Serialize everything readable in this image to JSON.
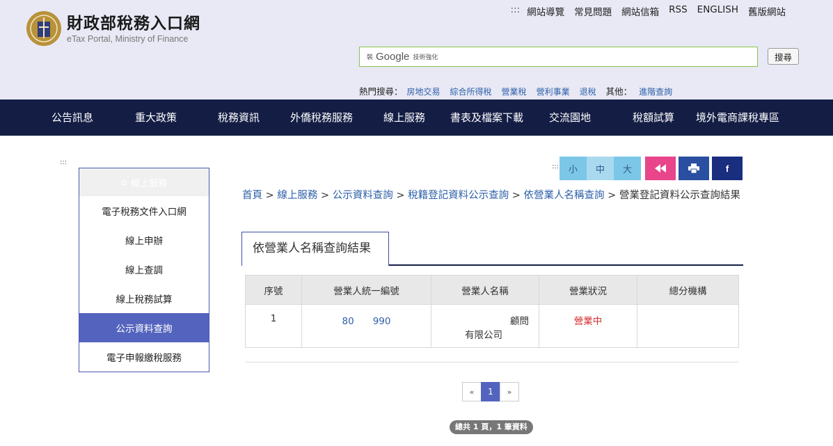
{
  "header": {
    "logo_title": "財政部稅務入口網",
    "logo_subtitle": "eTax Portal, Ministry of Finance",
    "top_links_dots": ":::",
    "top_links": [
      "網站導覽",
      "常見問題",
      "網站信箱",
      "RSS",
      "ENGLISH",
      "舊版網站"
    ],
    "search_placeholder_prefix": "裝",
    "search_brand": "Google",
    "search_suffix": "技術強化",
    "search_button": "搜尋",
    "hot_label": "熱門搜尋：",
    "hot_links": [
      "房地交易",
      "綜合所得稅",
      "營業稅",
      "營利事業",
      "退稅"
    ],
    "other_label": "其他：",
    "other_link": "進階查詢"
  },
  "nav": {
    "items": [
      "公告訊息",
      "重大政策",
      "稅務資訊",
      "外僑稅務服務",
      "線上服務",
      "書表及檔案下載",
      "交流園地",
      "稅額試算",
      "境外電商課稅專區"
    ]
  },
  "sidebar": {
    "dots": ":::",
    "heading": "線上服務",
    "items": [
      "電子稅務文件入口網",
      "線上申辦",
      "線上查調",
      "線上稅務試算",
      "公示資料查詢",
      "電子申報繳稅服務"
    ]
  },
  "toolbar": {
    "dots": ":::",
    "font_small": "小",
    "font_medium": "中",
    "font_large": "大"
  },
  "breadcrumb": {
    "sep": ">",
    "items": [
      "首頁",
      "線上服務",
      "公示資料查詢",
      "稅籍登記資料公示查詢",
      "依營業人名稱查詢"
    ],
    "current": "營業登記資料公示查詢結果"
  },
  "tab": {
    "label": "依營業人名稱查詢結果"
  },
  "table": {
    "headers": [
      "序號",
      "營業人統一編號",
      "營業人名稱",
      "營業狀況",
      "總分機構"
    ],
    "rows": [
      {
        "no": "1",
        "id": "80　　990",
        "name_line1": "顧問",
        "name_line2": "有限公司",
        "status": "營業中",
        "branch": ""
      }
    ]
  },
  "pager": {
    "prev": "«",
    "current": "1",
    "next": "»",
    "total": "總共 1 頁，1 筆資料"
  },
  "colors": {
    "nav_bg": "#141e45",
    "accent": "#5464be",
    "status_active": "#d32f2f",
    "pink": "#e8458b"
  }
}
